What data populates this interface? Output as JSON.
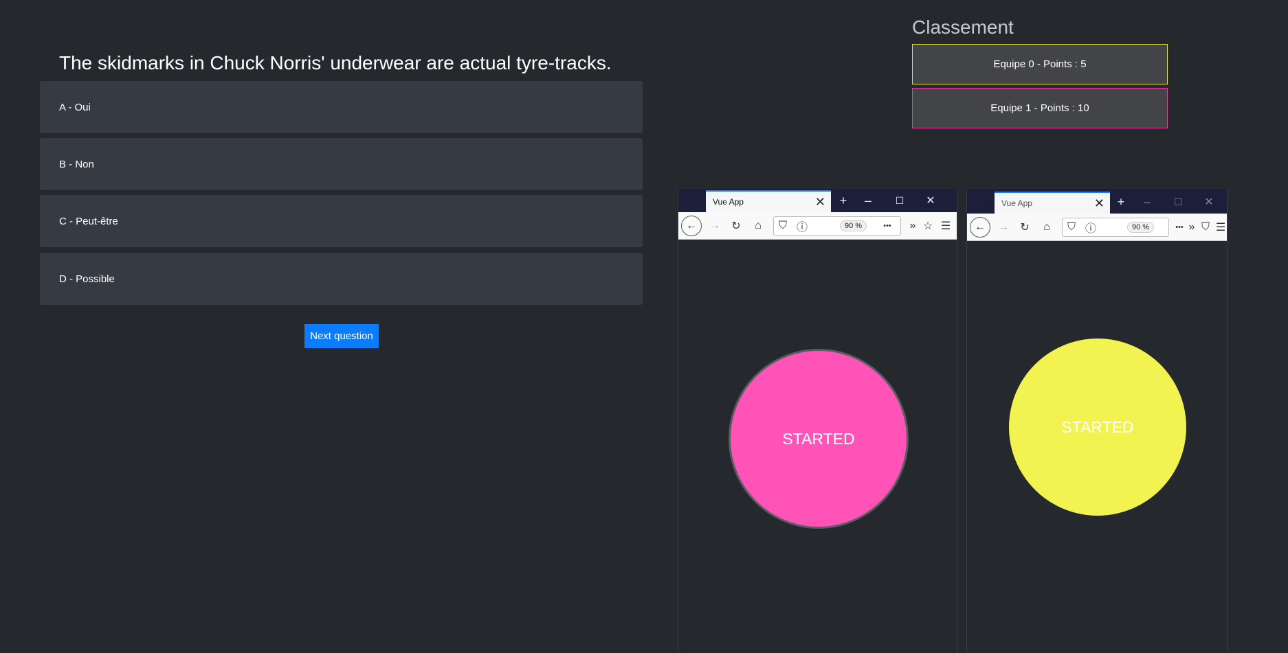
{
  "quiz": {
    "question": "The skidmarks in Chuck Norris' underwear are actual tyre-tracks.",
    "answers": [
      {
        "label": "A - Oui"
      },
      {
        "label": "B - Non"
      },
      {
        "label": "C - Peut-être"
      },
      {
        "label": "D - Possible"
      }
    ],
    "next_label": "Next question",
    "accent": "#0b7dfc"
  },
  "leaderboard": {
    "title": "Classement",
    "teams": [
      {
        "label": "Equipe 0 - Points : 5",
        "border_color": "#e6e12d"
      },
      {
        "label": "Equipe 1 - Points : 10",
        "border_color": "#e83e9e"
      }
    ]
  },
  "browsers": [
    {
      "tab_title": "Vue App",
      "zoom": "90 %",
      "button_label": "STARTED",
      "button_color": "#ff53b8"
    },
    {
      "tab_title": "Vue App",
      "zoom": "90 %",
      "button_label": "STARTED",
      "button_color": "#f2f250"
    }
  ],
  "icons": {
    "tab_close": "✕",
    "new_tab": "+",
    "minimize": "–",
    "maximize": "☐",
    "close": "✕",
    "back": "←",
    "forward": "→",
    "reload": "↻",
    "home": "⌂",
    "shield": "⛉",
    "info": "ⓘ",
    "more": "•••",
    "star": "☆",
    "menu": "☰",
    "overflow": "»"
  }
}
